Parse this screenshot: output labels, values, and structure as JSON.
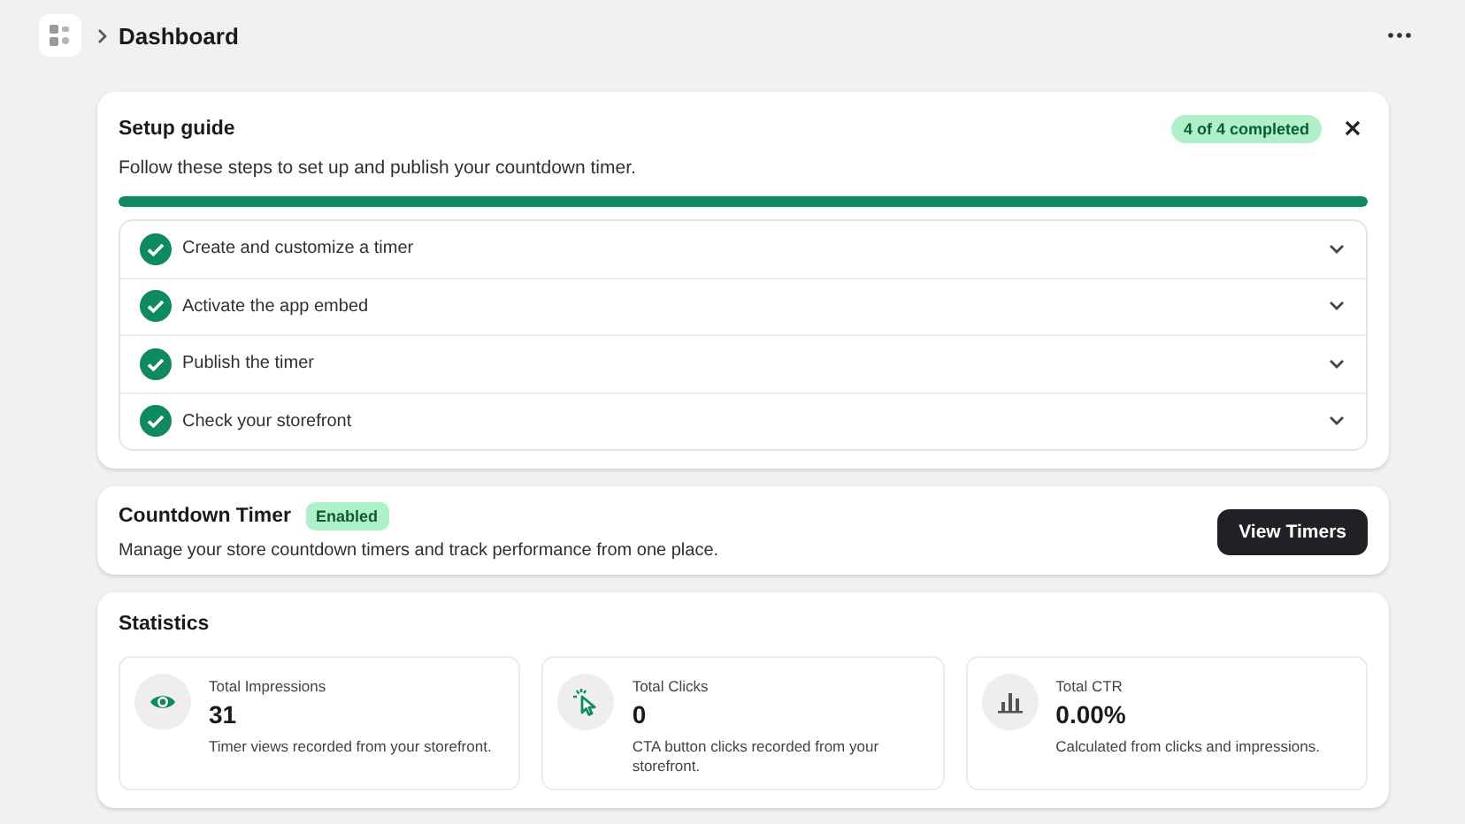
{
  "header": {
    "title": "Dashboard"
  },
  "setup_guide": {
    "title": "Setup guide",
    "badge": "4 of 4 completed",
    "description": "Follow these steps to set up and publish your countdown timer.",
    "progress": {
      "level": 1
    },
    "steps": [
      {
        "label": "Create and customize a timer",
        "checked": true,
        "expanded": false
      },
      {
        "label": "Activate the app embed",
        "checked": true,
        "expanded": false
      },
      {
        "label": "Publish the timer",
        "checked": true,
        "expanded": false
      },
      {
        "label": "Check your storefront",
        "checked": true,
        "expanded": false
      }
    ]
  },
  "countdown_timer": {
    "title": "Countdown Timer",
    "status": "Enabled",
    "enabled": true,
    "description": "Manage your store countdown timers and track performance from one place.",
    "button": "View Timers"
  },
  "statistics": {
    "title": "Statistics",
    "cards": [
      {
        "kind": "eye",
        "label": "Total Impressions",
        "value": "31",
        "note": "Timer views recorded from your storefront."
      },
      {
        "kind": "pointer",
        "label": "Total Clicks",
        "value": "0",
        "note": "CTA button clicks recorded from your storefront."
      },
      {
        "kind": "bars",
        "label": "Total CTR",
        "value": "0.00%",
        "note": "Calculated from clicks and impressions."
      }
    ]
  }
}
